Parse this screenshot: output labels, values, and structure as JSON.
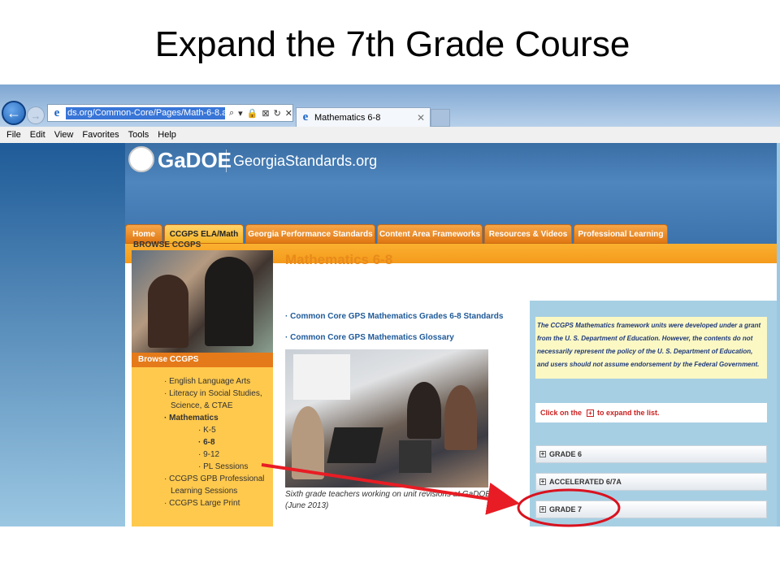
{
  "slide": {
    "title": "Expand the 7th Grade Course"
  },
  "browser": {
    "url": "ds.org/Common-Core/Pages/Math-6-8.aspx",
    "address_tools": [
      "⌕",
      "▾",
      "🔒",
      "⊠",
      "↻",
      "✕"
    ],
    "tab_title": "Mathematics 6-8",
    "tab_close": "✕",
    "faded_title": "",
    "back_glyph": "←",
    "forward_glyph": "→",
    "ie_glyph": "e",
    "menu": [
      "File",
      "Edit",
      "View",
      "Favorites",
      "Tools",
      "Help"
    ]
  },
  "header": {
    "logo_text": "GaDOE",
    "site_name": "GeorgiaStandards.org"
  },
  "nav_tabs": [
    {
      "label": "Home",
      "active": false
    },
    {
      "label": "CCGPS ELA/Math",
      "active": true
    },
    {
      "label": "Georgia Performance Standards",
      "active": false
    },
    {
      "label": "Content Area Frameworks",
      "active": false
    },
    {
      "label": "Resources & Videos",
      "active": false
    },
    {
      "label": "Professional Learning",
      "active": false
    }
  ],
  "sidebar": {
    "label": "BROWSE CCGPS",
    "box_header": "Browse CCGPS",
    "items": [
      {
        "label": "· English Language Arts"
      },
      {
        "label": "· Literacy in Social Studies,"
      },
      {
        "label": "Science, & CTAE"
      },
      {
        "label": "· Mathematics"
      },
      {
        "label": "· K-5"
      },
      {
        "label": "· 6-8"
      },
      {
        "label": "· 9-12"
      },
      {
        "label": "· PL Sessions"
      },
      {
        "label": "· CCGPS GPB Professional"
      },
      {
        "label": "Learning Sessions"
      },
      {
        "label": "· CCGPS Large Print"
      }
    ]
  },
  "main": {
    "heading": "Mathematics 6-8",
    "links": [
      "· Common Core GPS Mathematics Grades 6-8 Standards",
      "· Common Core GPS Mathematics Glossary"
    ],
    "caption": "Sixth grade teachers working on unit revisions at GaDOE (June 2013)"
  },
  "panel": {
    "disclaimer": "The CCGPS Mathematics framework units were developed under a grant from the U. S. Department of Education. However, the contents do not necessarily represent the policy of the U. S. Department of Education, and users should not assume endorsement by the Federal Government.",
    "note_before": "Click on the",
    "note_after": "to expand the list.",
    "plus_glyph": "+",
    "grades": [
      "GRADE 6",
      "ACCELERATED 6/7A",
      "GRADE 7"
    ]
  },
  "annotation_colors": {
    "arrow": "#e81c24",
    "circle": "#d9121f"
  }
}
